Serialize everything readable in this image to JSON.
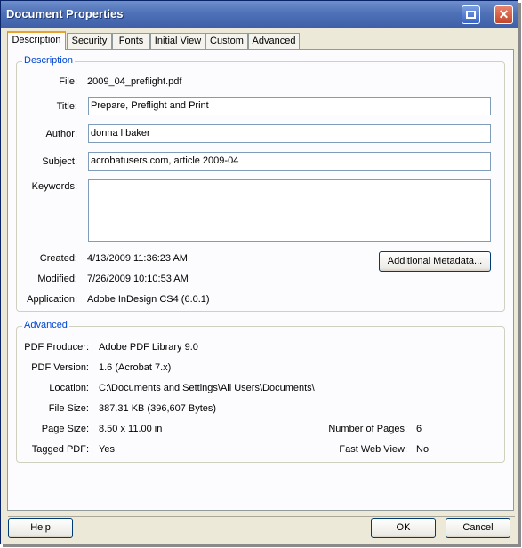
{
  "window": {
    "title": "Document Properties"
  },
  "tabs": [
    "Description",
    "Security",
    "Fonts",
    "Initial View",
    "Custom",
    "Advanced"
  ],
  "description": {
    "group_label": "Description",
    "file_label": "File:",
    "file_value": "2009_04_preflight.pdf",
    "title_label": "Title:",
    "title_value": "Prepare, Preflight and Print",
    "author_label": "Author:",
    "author_value": "donna l baker",
    "subject_label": "Subject:",
    "subject_value": "acrobatusers.com, article 2009-04",
    "keywords_label": "Keywords:",
    "keywords_value": "",
    "created_label": "Created:",
    "created_value": "4/13/2009 11:36:23 AM",
    "modified_label": "Modified:",
    "modified_value": "7/26/2009 10:10:53 AM",
    "application_label": "Application:",
    "application_value": "Adobe InDesign CS4 (6.0.1)",
    "metadata_button": "Additional Metadata..."
  },
  "advanced": {
    "group_label": "Advanced",
    "producer_label": "PDF Producer:",
    "producer_value": "Adobe PDF Library 9.0",
    "version_label": "PDF Version:",
    "version_value": "1.6 (Acrobat 7.x)",
    "location_label": "Location:",
    "location_value": "C:\\Documents and Settings\\All Users\\Documents\\",
    "filesize_label": "File Size:",
    "filesize_value": "387.31 KB (396,607 Bytes)",
    "pagesize_label": "Page Size:",
    "pagesize_value": "8.50 x 11.00 in",
    "pages_label": "Number of Pages:",
    "pages_value": "6",
    "tagged_label": "Tagged PDF:",
    "tagged_value": "Yes",
    "fastweb_label": "Fast Web View:",
    "fastweb_value": "No"
  },
  "footer": {
    "help": "Help",
    "ok": "OK",
    "cancel": "Cancel"
  },
  "icons": {
    "restore": "window-restore-icon",
    "close": "close-icon"
  },
  "colors": {
    "titlebar": "#4f71b8",
    "group_label": "#0046d5",
    "active_tab_accent": "#e8a22f"
  }
}
